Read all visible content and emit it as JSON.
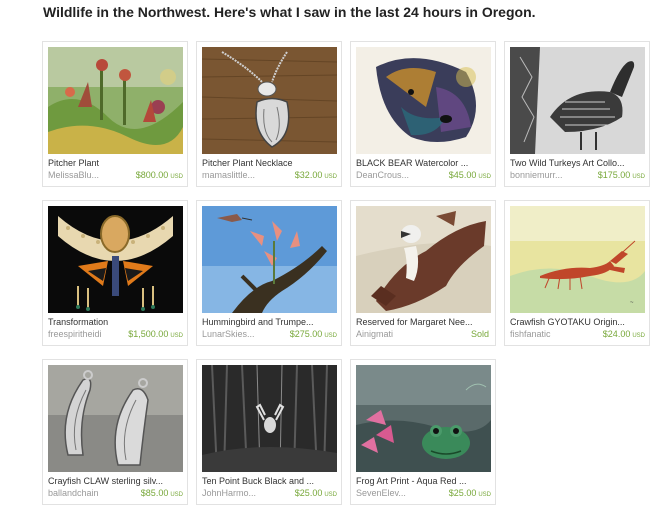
{
  "heading": "Wildlife in the Northwest. Here's what I saw in the last 24 hours in Oregon.",
  "items": [
    {
      "title": "Pitcher Plant",
      "shop": "MelissaBlu...",
      "price": "$800.00",
      "currency": "USD"
    },
    {
      "title": "Pitcher Plant Necklace",
      "shop": "mamaslittle...",
      "price": "$32.00",
      "currency": "USD"
    },
    {
      "title": "BLACK BEAR Watercolor ...",
      "shop": "DeanCrous...",
      "price": "$45.00",
      "currency": "USD"
    },
    {
      "title": "Two Wild Turkeys Art Collo...",
      "shop": "bonniemurr...",
      "price": "$175.00",
      "currency": "USD"
    },
    {
      "title": "Transformation",
      "shop": "freespiritheidi",
      "price": "$1,500.00",
      "currency": "USD"
    },
    {
      "title": "Hummingbird and Trumpe...",
      "shop": "LunarSkies...",
      "price": "$275.00",
      "currency": "USD"
    },
    {
      "title": "Reserved for Margaret Nee...",
      "shop": "Ainigmati",
      "status": "Sold"
    },
    {
      "title": "Crawfish GYOTAKU Origin...",
      "shop": "fishfanatic",
      "price": "$24.00",
      "currency": "USD"
    },
    {
      "title": "Crayfish CLAW sterling silv...",
      "shop": "ballandchain",
      "price": "$85.00",
      "currency": "USD"
    },
    {
      "title": "Ten Point Buck Black and ...",
      "shop": "JohnHarmo...",
      "price": "$25.00",
      "currency": "USD"
    },
    {
      "title": "Frog Art Print - Aqua Red ...",
      "shop": "SevenElev...",
      "price": "$25.00",
      "currency": "USD"
    }
  ],
  "colors": {
    "price": "#78a83a",
    "border": "#e2e2e2",
    "shop": "#999999"
  }
}
